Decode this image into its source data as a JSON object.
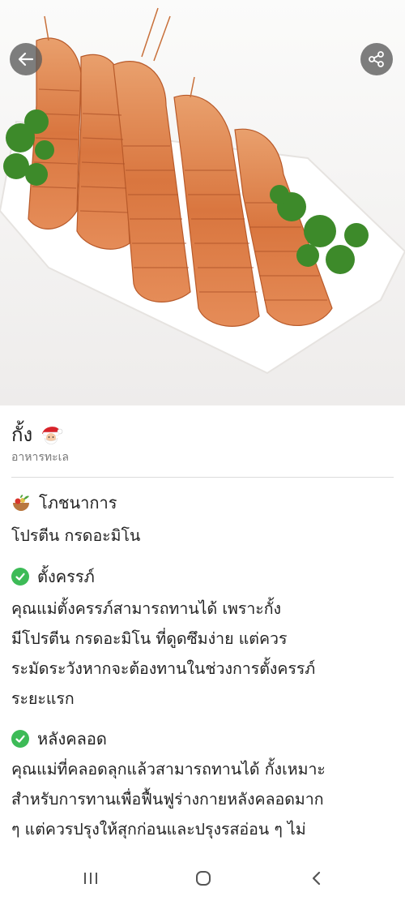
{
  "header": {
    "back_icon": "arrow-left-icon",
    "share_icon": "share-icon"
  },
  "food": {
    "name": "กั้ง",
    "emoji_icon": "santa-claus-icon",
    "category": "อาหารทะเล"
  },
  "nutrition": {
    "icon": "salad-bowl-icon",
    "heading": "โภชนาการ",
    "value": "โปรตีน กรดอะมิโน"
  },
  "pregnant": {
    "icon": "check-circle-icon",
    "heading": "ตั้งครรภ์",
    "lines": [
      "คุณแม่ตั้งครรภ์สามารถทานได้ เพราะกั้ง",
      "มีโปรตีน กรดอะมิโน ที่ดูดซึมง่าย แต่ควร",
      "ระมัดระวังหากจะต้องทานในช่วงการตั้งครรภ์",
      "ระยะแรก"
    ]
  },
  "postpartum": {
    "icon": "check-circle-icon",
    "heading": "หลังคลอด",
    "lines": [
      "คุณแม่ที่คลอดลุกแล้วสามารถทานได้ กั้งเหมาะ",
      "สำหรับการทานเพื่อฟื้นฟูร่างกายหลังคลอดมาก",
      "ๆ แต่ควรปรุงให้สุกก่อนและปรุงรสอ่อน ๆ ไม่"
    ]
  },
  "navbar": {
    "recents_icon": "recent-apps-icon",
    "home_icon": "home-circle-icon",
    "back_icon": "chevron-left-icon"
  },
  "colors": {
    "accent_green": "#3dbb57",
    "overlay_button": "#5a5a5a",
    "divider": "#dcdcdc"
  }
}
